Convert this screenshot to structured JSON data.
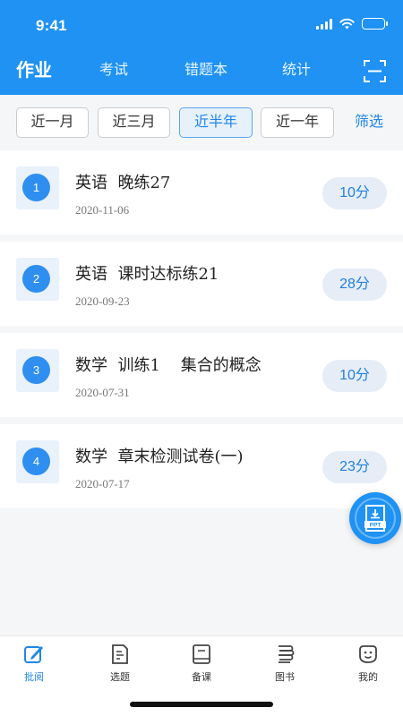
{
  "status_bar": {
    "time": "9:41"
  },
  "header": {
    "tabs": [
      {
        "label": "作业",
        "active": true
      },
      {
        "label": "考试",
        "active": false
      },
      {
        "label": "错题本",
        "active": false
      },
      {
        "label": "统计",
        "active": false
      }
    ],
    "scan_icon": "scan-icon"
  },
  "filters": {
    "options": [
      {
        "label": "近一月",
        "active": false
      },
      {
        "label": "近三月",
        "active": false
      },
      {
        "label": "近半年",
        "active": true
      },
      {
        "label": "近一年",
        "active": false
      }
    ],
    "filter_label": "筛选"
  },
  "assignments": [
    {
      "index": "1",
      "title": "英语  晚练27",
      "date": "2020-11-06",
      "score": "10分"
    },
    {
      "index": "2",
      "title": "英语  课时达标练21",
      "date": "2020-09-23",
      "score": "28分"
    },
    {
      "index": "3",
      "title": "数学  训练1    集合的概念",
      "date": "2020-07-31",
      "score": "10分"
    },
    {
      "index": "4",
      "title": "数学  章末检测试卷(一)",
      "date": "2020-07-17",
      "score": "23分"
    }
  ],
  "fab": {
    "icon": "ppt-download-icon",
    "label": "PPT"
  },
  "tabbar": {
    "items": [
      {
        "label": "批阅",
        "icon": "grading-icon",
        "active": true
      },
      {
        "label": "选题",
        "icon": "question-select-icon",
        "active": false
      },
      {
        "label": "备课",
        "icon": "lesson-prep-icon",
        "active": false
      },
      {
        "label": "图书",
        "icon": "books-icon",
        "active": false
      },
      {
        "label": "我的",
        "icon": "profile-icon",
        "active": false
      }
    ]
  },
  "colors": {
    "primary": "#1f92f3",
    "accent_text": "#1f86e9",
    "score_bg": "#e6edf6"
  }
}
